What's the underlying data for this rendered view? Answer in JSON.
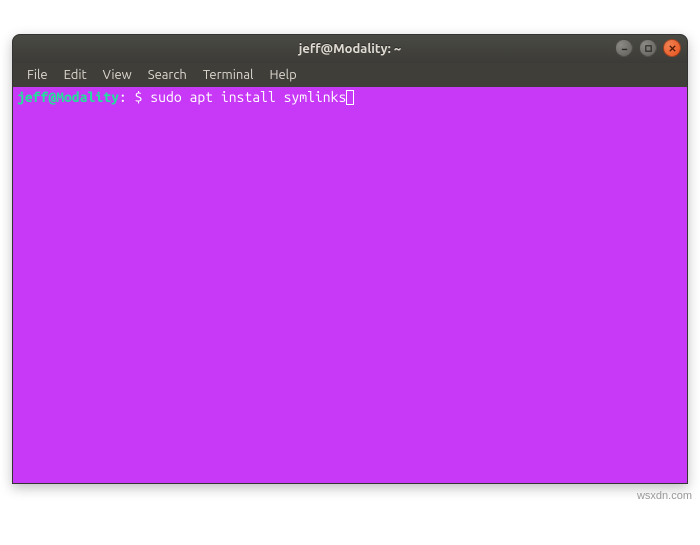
{
  "window": {
    "title": "jeff@Modality: ~"
  },
  "menubar": {
    "items": [
      "File",
      "Edit",
      "View",
      "Search",
      "Terminal",
      "Help"
    ]
  },
  "prompt": {
    "user_host": "jeff@Modality",
    "separator1": ":",
    "path": " ",
    "dollar": "$ ",
    "command": "sudo apt install symlinks"
  },
  "watermark": "wsxdn.com"
}
